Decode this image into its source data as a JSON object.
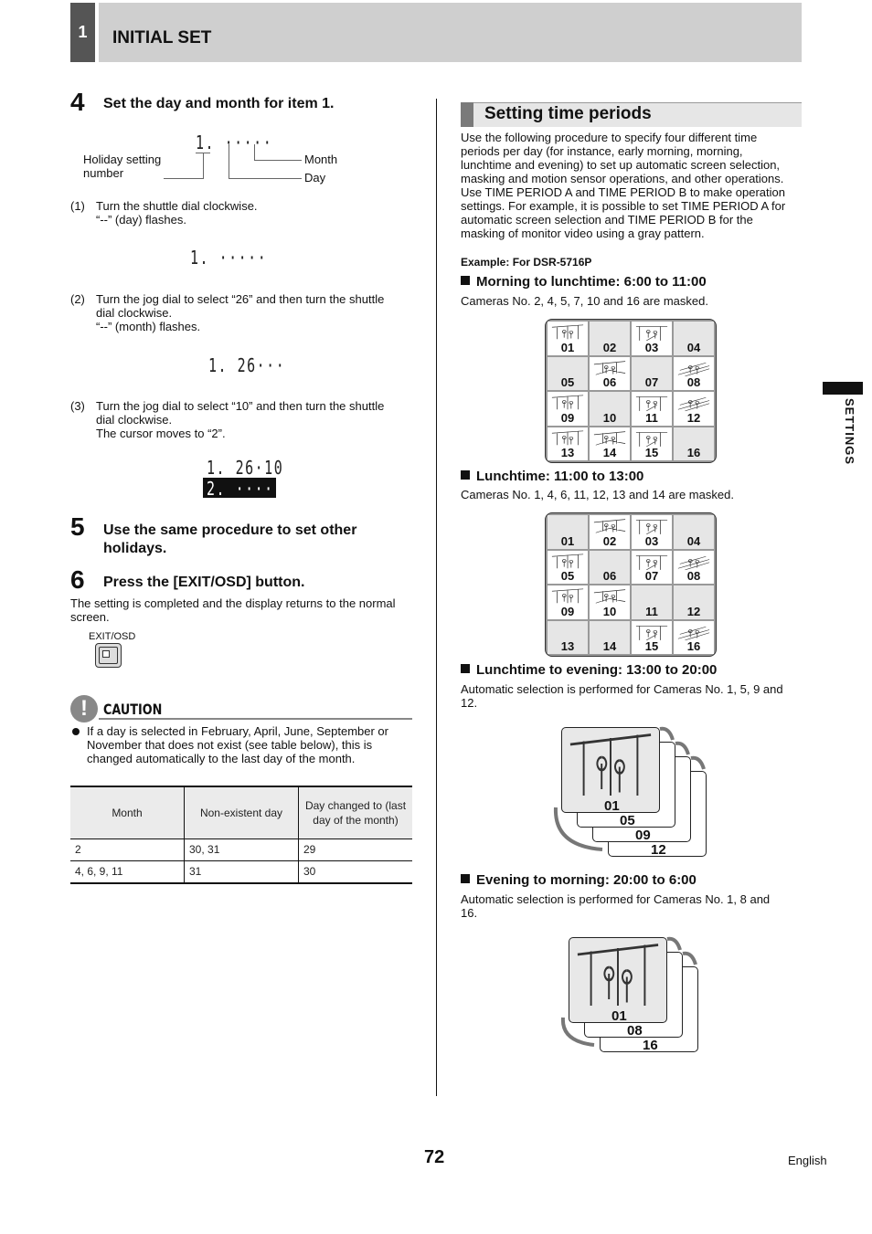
{
  "header": {
    "chapter_number": "1",
    "chapter_title": "INITIAL SET"
  },
  "left": {
    "step4": {
      "number": "4",
      "title": "Set the day and month for item 1.",
      "diagram": {
        "display": "1. ·····",
        "label_holiday": "Holiday setting number",
        "label_month": "Month",
        "label_day": "Day"
      },
      "substeps": [
        {
          "num": "(1)",
          "lines": [
            "Turn the shuttle dial clockwise.",
            "“--” (day) flashes."
          ],
          "display": "1. ·····"
        },
        {
          "num": "(2)",
          "lines": [
            "Turn the jog dial to select “26” and then turn the shuttle",
            "dial clockwise.",
            "“--” (month) flashes."
          ],
          "display": "1. 26···"
        },
        {
          "num": "(3)",
          "lines": [
            "Turn the jog dial to select “10” and then turn the shuttle",
            "dial clockwise.",
            "The cursor moves to “2”."
          ],
          "display": "1. 26·10",
          "display_selected": "2. ·····"
        }
      ]
    },
    "step5": {
      "number": "5",
      "title_line1": "Use the same procedure to set other",
      "title_line2": "holidays."
    },
    "step6": {
      "number": "6",
      "title": "Press the [EXIT/OSD] button.",
      "text_line1": "The setting is completed and the display returns to the normal",
      "text_line2": "screen.",
      "button_label": "EXIT/OSD"
    },
    "caution": {
      "icon": "exclamation-icon",
      "title": "CAUTION",
      "bullet_lines": [
        "If a day is selected in February, April, June, September or",
        "November that does not exist (see table below), this is",
        "changed automatically to the last day of the month."
      ]
    },
    "table": {
      "headers": [
        "Month",
        "Non-existent day",
        "Day changed to (last day of the month)"
      ],
      "rows": [
        [
          "2",
          "30, 31",
          "29"
        ],
        [
          "4, 6, 9, 11",
          "31",
          "30"
        ]
      ]
    }
  },
  "right": {
    "section_title": "Setting time periods",
    "intro_lines": [
      "Use the following procedure to specify four different time",
      "periods per day (for instance, early morning, morning,",
      "lunchtime and evening) to set up automatic screen selection,",
      "masking and motion sensor operations, and other operations.",
      "Use TIME PERIOD A and TIME PERIOD B to make operation",
      "settings. For example, it is possible to set TIME PERIOD A for",
      "automatic screen selection and TIME PERIOD B for the",
      "masking of monitor video using a gray pattern."
    ],
    "example_label": "Example: For DSR-5716P",
    "periods": [
      {
        "heading": "Morning to lunchtime: 6:00 to 11:00",
        "description": "Cameras No. 2, 4, 5, 7, 10 and 16 are masked.",
        "cameras": [
          "01",
          "02",
          "03",
          "04",
          "05",
          "06",
          "07",
          "08",
          "09",
          "10",
          "11",
          "12",
          "13",
          "14",
          "15",
          "16"
        ],
        "masked": [
          "02",
          "04",
          "05",
          "07",
          "10",
          "16"
        ]
      },
      {
        "heading": "Lunchtime: 11:00 to 13:00",
        "description": "Cameras No. 1, 4, 6, 11, 12, 13 and 14 are masked.",
        "cameras": [
          "01",
          "02",
          "03",
          "04",
          "05",
          "06",
          "07",
          "08",
          "09",
          "10",
          "11",
          "12",
          "13",
          "14",
          "15",
          "16"
        ],
        "masked": [
          "01",
          "04",
          "06",
          "11",
          "12",
          "13",
          "14"
        ]
      },
      {
        "heading": "Lunchtime to evening: 13:00 to 20:00",
        "description_line1": "Automatic selection is performed for Cameras No. 1, 5, 9 and",
        "description_line2": "12.",
        "sequence": [
          "01",
          "05",
          "09",
          "12"
        ]
      },
      {
        "heading": "Evening to morning: 20:00 to 6:00",
        "description_line1": "Automatic selection is performed for Cameras No. 1, 8 and",
        "description_line2": "16.",
        "sequence": [
          "01",
          "08",
          "16"
        ]
      }
    ]
  },
  "side_tab": "SETTINGS",
  "footer": {
    "page_number": "72",
    "language": "English"
  }
}
